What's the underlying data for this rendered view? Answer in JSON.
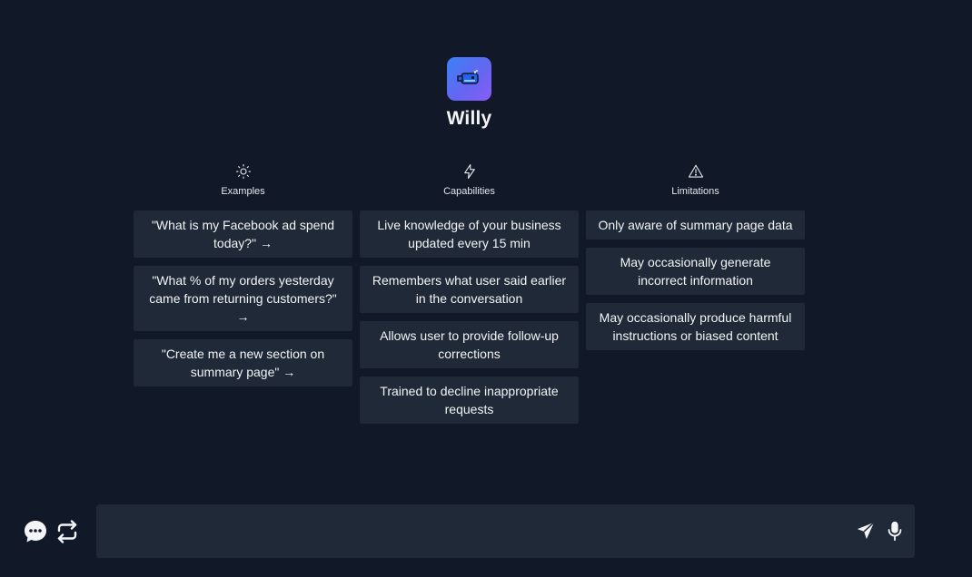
{
  "app": {
    "name": "Willy",
    "logo_icon": "whale-icon",
    "accent_gradient": [
      "#3b82f6",
      "#8b5cf6"
    ]
  },
  "columns": {
    "examples": {
      "icon": "sun-icon",
      "title": "Examples",
      "items": [
        "\"What is my Facebook ad spend today?\" →",
        "\"What % of my orders yesterday came from returning customers?\" →",
        "\"Create me a new section on summary page\" →"
      ]
    },
    "capabilities": {
      "icon": "lightning-icon",
      "title": "Capabilities",
      "items": [
        "Live knowledge of your business updated every 15 min",
        "Remembers what user said earlier in the conversation",
        "Allows user to provide follow-up corrections",
        "Trained to decline inappropriate requests"
      ]
    },
    "limitations": {
      "icon": "warning-icon",
      "title": "Limitations",
      "items": [
        "Only aware of summary page data",
        "May occasionally generate incorrect information",
        "May occasionally produce harmful instructions or biased content"
      ]
    }
  },
  "composer": {
    "placeholder": "",
    "value": "",
    "send_icon": "send-icon",
    "mic_icon": "microphone-icon"
  },
  "bottom_left": {
    "chat_icon": "chat-bubble-icon",
    "repeat_icon": "repeat-icon"
  },
  "colors": {
    "background": "#111827",
    "card": "#1f2937",
    "text": "#f3f4f6"
  }
}
